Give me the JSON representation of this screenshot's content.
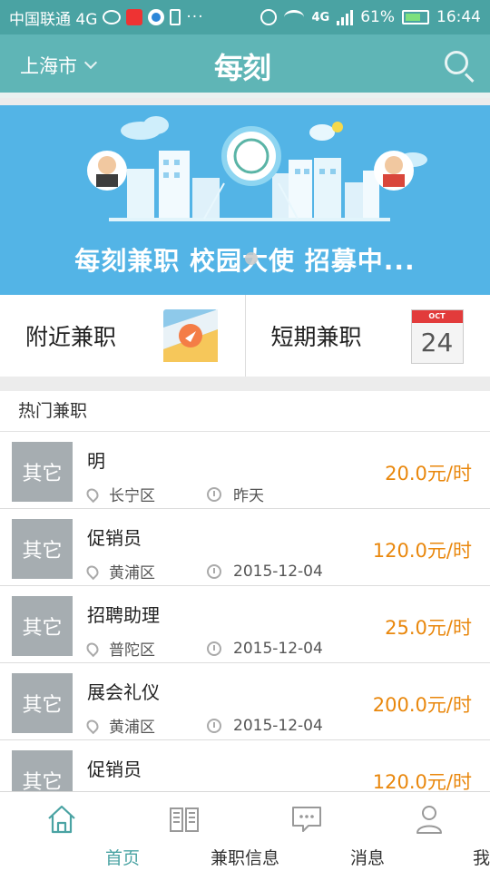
{
  "status_bar": {
    "carrier": "中国联通 4G",
    "battery": "61%",
    "time": "16:44",
    "net_label": "4G"
  },
  "header": {
    "city": "上海市",
    "logo": "每刻"
  },
  "banner": {
    "caption": "每刻兼职 校园大使 招募中..."
  },
  "quick_entries": [
    {
      "label": "附近兼职",
      "icon": "map-icon"
    },
    {
      "label": "短期兼职",
      "icon": "calendar-icon",
      "cal_month": "OCT",
      "cal_day": "24"
    }
  ],
  "section": {
    "title": "热门兼职"
  },
  "jobs": [
    {
      "tag": "其它",
      "title": "明",
      "district": "长宁区",
      "time": "昨天",
      "price": "20.0元/时"
    },
    {
      "tag": "其它",
      "title": "促销员",
      "district": "黄浦区",
      "time": "2015-12-04",
      "price": "120.0元/时"
    },
    {
      "tag": "其它",
      "title": "招聘助理",
      "district": "普陀区",
      "time": "2015-12-04",
      "price": "25.0元/时"
    },
    {
      "tag": "其它",
      "title": "展会礼仪",
      "district": "黄浦区",
      "time": "2015-12-04",
      "price": "200.0元/时"
    },
    {
      "tag": "其它",
      "title": "促销员",
      "district": "",
      "time": "",
      "price": "120.0元/时"
    }
  ],
  "bottom_nav": [
    {
      "label": "首页",
      "icon": "home-icon",
      "active": true
    },
    {
      "label": "兼职信息",
      "icon": "book-icon",
      "active": false
    },
    {
      "label": "消息",
      "icon": "message-icon",
      "active": false
    },
    {
      "label": "我的",
      "icon": "user-icon",
      "active": false
    }
  ],
  "colors": {
    "header": "#5fb5b6",
    "status_bar": "#4aa3a3",
    "price": "#e9870c",
    "tag": "#a6adb1",
    "active_nav": "#4aa3a3",
    "banner": "#53b4e6"
  }
}
